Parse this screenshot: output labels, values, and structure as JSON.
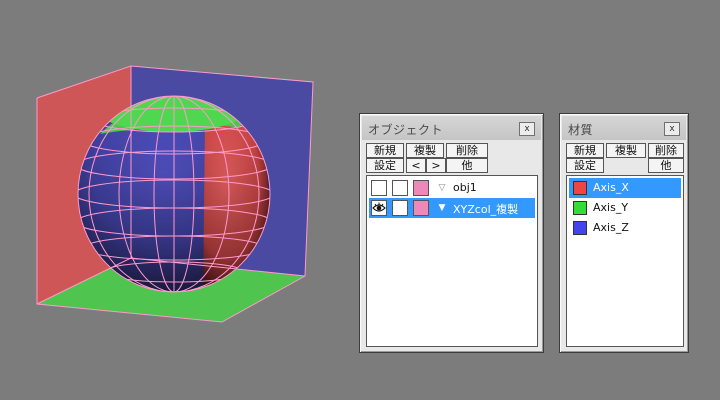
{
  "viewport": {
    "colors": {
      "x_axis": "#cf5656",
      "y_axis": "#4fc44f",
      "z_axis": "#4a4aa2",
      "wireframe": "#ff99cc"
    }
  },
  "object_panel": {
    "title": "オブジェクト",
    "close_label": "x",
    "buttons": {
      "new": "新規",
      "copy": "複製",
      "delete": "削除",
      "settings": "設定",
      "prev": "<",
      "next": ">",
      "other": "他"
    },
    "rows": [
      {
        "name": "obj1",
        "swatch_color": "#ee88bb",
        "visible": false,
        "expander_icon": "triangle-down-outline",
        "expander_glyph": "▽",
        "selected": false
      },
      {
        "name": "XYZcol_複製",
        "swatch_color": "#ee88bb",
        "visible": true,
        "expander_icon": "triangle-down-filled",
        "expander_glyph": "▼",
        "selected": true
      }
    ]
  },
  "material_panel": {
    "title": "材質",
    "close_label": "x",
    "buttons": {
      "new": "新規",
      "copy": "複製",
      "delete": "削除",
      "settings": "設定",
      "other": "他"
    },
    "items": [
      {
        "name": "Axis_X",
        "color": "#ee4444",
        "selected": true
      },
      {
        "name": "Axis_Y",
        "color": "#33dd33",
        "selected": false
      },
      {
        "name": "Axis_Z",
        "color": "#4444ee",
        "selected": false
      }
    ]
  }
}
